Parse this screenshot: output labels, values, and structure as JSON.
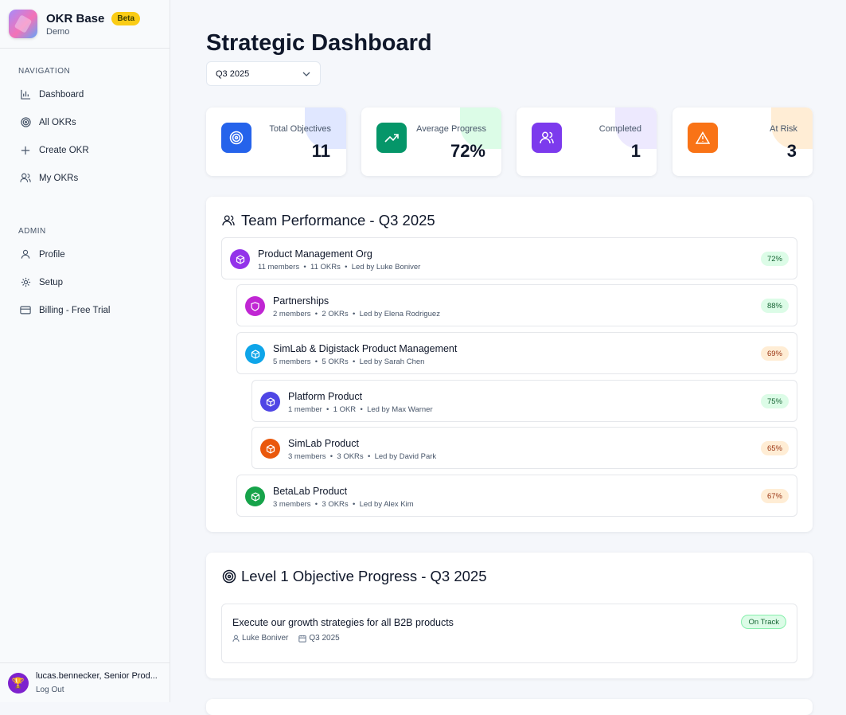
{
  "brand": {
    "name": "OKR Base",
    "badge": "Beta",
    "subtitle": "Demo"
  },
  "navigation": {
    "section_title": "NAVIGATION",
    "items": [
      {
        "label": "Dashboard",
        "icon": "bar-chart-icon"
      },
      {
        "label": "All OKRs",
        "icon": "target-icon"
      },
      {
        "label": "Create OKR",
        "icon": "plus-icon"
      },
      {
        "label": "My OKRs",
        "icon": "users-icon"
      }
    ]
  },
  "admin": {
    "section_title": "ADMIN",
    "items": [
      {
        "label": "Profile",
        "icon": "user-icon"
      },
      {
        "label": "Setup",
        "icon": "gear-icon"
      },
      {
        "label": "Billing - Free Trial",
        "icon": "credit-card-icon"
      }
    ]
  },
  "user": {
    "name": "lucas.bennecker, Senior Prod...",
    "logout": "Log Out"
  },
  "page": {
    "title": "Strategic Dashboard",
    "quarter_select": "Q3 2025"
  },
  "stats": [
    {
      "label": "Total Objectives",
      "value": "11",
      "color": "#2563eb",
      "icon": "target-icon"
    },
    {
      "label": "Average Progress",
      "value": "72%",
      "color": "#059669",
      "icon": "trending-up-icon"
    },
    {
      "label": "Completed",
      "value": "1",
      "color": "#7c3aed",
      "icon": "users-icon"
    },
    {
      "label": "At Risk",
      "value": "3",
      "color": "#f97316",
      "icon": "warning-icon"
    }
  ],
  "team_performance": {
    "title": "Team Performance - Q3 2025",
    "teams": [
      {
        "name": "Product Management Org",
        "members": "11 members",
        "okrs": "11 OKRs",
        "lead": "Led by Luke Boniver",
        "progress": "72%",
        "status": "good",
        "color": "#9333ea"
      },
      {
        "name": "Partnerships",
        "members": "2 members",
        "okrs": "2 OKRs",
        "lead": "Led by Elena Rodriguez",
        "progress": "88%",
        "status": "good",
        "color": "#c026d3"
      },
      {
        "name": "SimLab & Digistack Product Management",
        "members": "5 members",
        "okrs": "5 OKRs",
        "lead": "Led by Sarah Chen",
        "progress": "69%",
        "status": "warn",
        "color": "#0ea5e9"
      },
      {
        "name": "Platform Product",
        "members": "1 member",
        "okrs": "1 OKR",
        "lead": "Led by Max Warner",
        "progress": "75%",
        "status": "good",
        "color": "#4f46e5"
      },
      {
        "name": "SimLab Product",
        "members": "3 members",
        "okrs": "3 OKRs",
        "lead": "Led by David Park",
        "progress": "65%",
        "status": "warn",
        "color": "#ea580c"
      },
      {
        "name": "BetaLab Product",
        "members": "3 members",
        "okrs": "3 OKRs",
        "lead": "Led by Alex Kim",
        "progress": "67%",
        "status": "warn",
        "color": "#16a34a"
      }
    ]
  },
  "objective_progress": {
    "title": "Level 1 Objective Progress - Q3 2025",
    "objective": {
      "title": "Execute our growth strategies for all B2B products",
      "owner": "Luke Boniver",
      "quarter": "Q3 2025",
      "status": "On Track"
    }
  }
}
